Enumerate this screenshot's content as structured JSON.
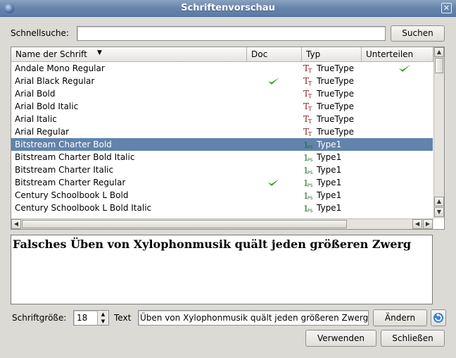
{
  "window": {
    "title": "Schriftenvorschau",
    "close_glyph": "✕"
  },
  "search": {
    "label": "Schnellsuche:",
    "value": "",
    "button": "Suchen"
  },
  "table": {
    "columns": [
      {
        "label": "Name der Schrift",
        "sorted": "descending"
      },
      {
        "label": "Doc"
      },
      {
        "label": "Typ"
      },
      {
        "label": "Unterteilen"
      }
    ],
    "rows": [
      {
        "name": "Andale Mono Regular",
        "doc": false,
        "type": "TrueType",
        "subset": true
      },
      {
        "name": "Arial Black Regular",
        "doc": true,
        "type": "TrueType",
        "subset": false
      },
      {
        "name": "Arial Bold",
        "doc": false,
        "type": "TrueType",
        "subset": false
      },
      {
        "name": "Arial Bold Italic",
        "doc": false,
        "type": "TrueType",
        "subset": false
      },
      {
        "name": "Arial Italic",
        "doc": false,
        "type": "TrueType",
        "subset": false
      },
      {
        "name": "Arial Regular",
        "doc": false,
        "type": "TrueType",
        "subset": false
      },
      {
        "name": "Bitstream Charter Bold",
        "doc": false,
        "type": "Type1",
        "subset": false,
        "selected": true
      },
      {
        "name": "Bitstream Charter Bold Italic",
        "doc": false,
        "type": "Type1",
        "subset": false
      },
      {
        "name": "Bitstream Charter Italic",
        "doc": false,
        "type": "Type1",
        "subset": false
      },
      {
        "name": "Bitstream Charter Regular",
        "doc": true,
        "type": "Type1",
        "subset": false
      },
      {
        "name": "Century Schoolbook L Bold",
        "doc": false,
        "type": "Type1",
        "subset": false
      },
      {
        "name": "Century Schoolbook L Bold Italic",
        "doc": false,
        "type": "Type1",
        "subset": false
      }
    ],
    "scroll_arrows": {
      "up": "▲",
      "down": "▼",
      "left": "◀",
      "right": "▶"
    }
  },
  "preview": {
    "text": "Falsches Üben von Xylophonmusik quält jeden größeren Zwerg"
  },
  "controls": {
    "size_label": "Schriftgröße:",
    "size_value": "18",
    "text_label": "Text",
    "text_value": "Üben von Xylophonmusik quält jeden größeren Zwerg",
    "change_button": "Ändern",
    "apply_button": "Verwenden",
    "close_button": "Schließen"
  },
  "icons": {
    "sort": "chevron-down-icon",
    "truetype": "truetype-icon",
    "type1": "type1-icon",
    "check": "checkmark-icon",
    "reset": "reset-icon"
  },
  "colors": {
    "selection": "#6283ab",
    "titlebar": "#6884ad",
    "check": "#3aa01c",
    "truetype": "#8b2020",
    "type1": "#1f6e2a"
  }
}
